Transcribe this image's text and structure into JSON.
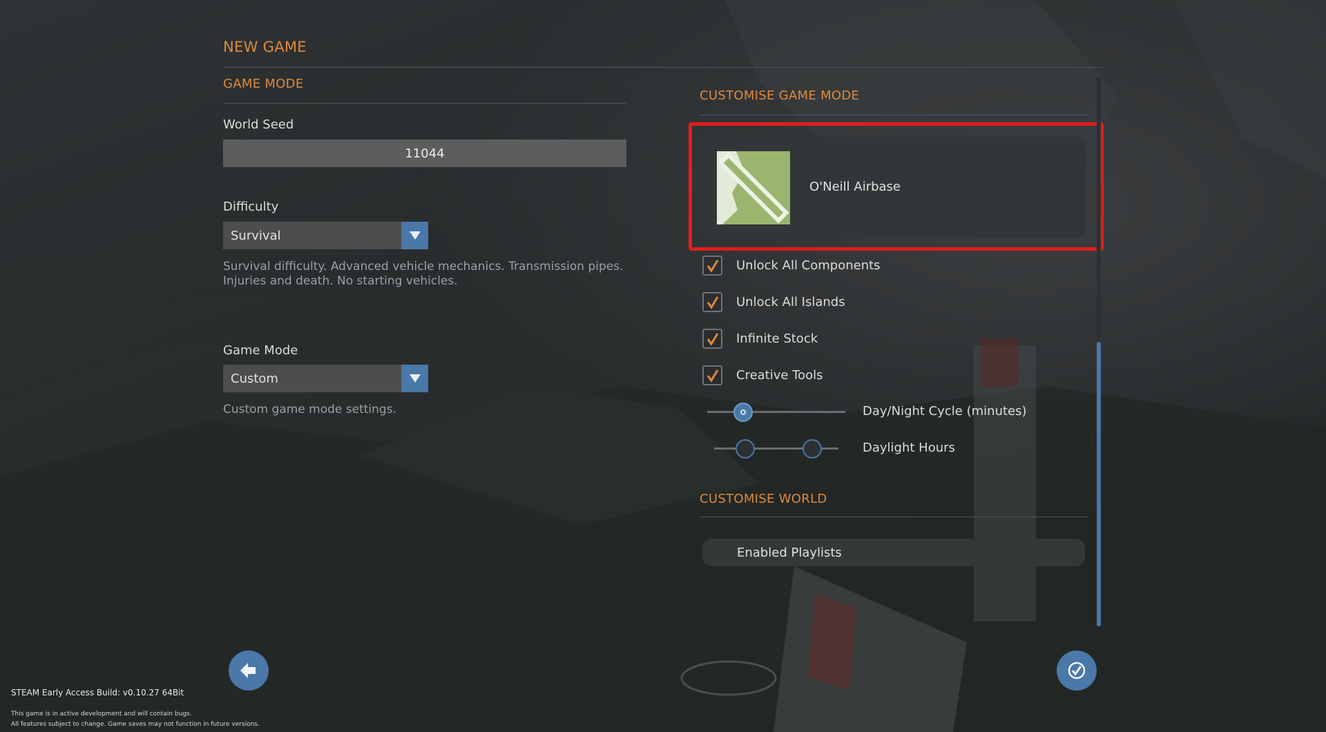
{
  "page": {
    "title": "NEW GAME",
    "accent_color": "#e0893c",
    "button_color": "#4a78a8",
    "highlight_color": "#e31d1d"
  },
  "game_mode_section": {
    "heading": "GAME MODE",
    "world_seed": {
      "label": "World Seed",
      "value": "11044"
    },
    "difficulty": {
      "label": "Difficulty",
      "selected": "Survival",
      "description": "Survival difficulty. Advanced vehicle mechanics. Transmission pipes. Injuries and death. No starting vehicles."
    },
    "game_mode": {
      "label": "Game Mode",
      "selected": "Custom",
      "description": "Custom game mode settings."
    }
  },
  "customise_game_mode": {
    "heading": "CUSTOMISE GAME MODE",
    "location": {
      "name": "O'Neill Airbase",
      "icon": "airbase-map-icon"
    },
    "options": [
      {
        "label": "Unlock All Components",
        "checked": true
      },
      {
        "label": "Unlock All Islands",
        "checked": true
      },
      {
        "label": "Infinite Stock",
        "checked": true
      },
      {
        "label": "Creative Tools",
        "checked": true
      }
    ],
    "sliders": {
      "day_night": {
        "label": "Day/Night Cycle (minutes)",
        "position_fraction": 0.26
      },
      "daylight": {
        "label": "Daylight Hours",
        "low_fraction": 0.25,
        "high_fraction": 0.79
      }
    }
  },
  "customise_world": {
    "heading": "CUSTOMISE WORLD",
    "playlists_button": "Enabled Playlists"
  },
  "navigation": {
    "back_icon": "arrow-left-icon",
    "confirm_icon": "checkmark-icon"
  },
  "footer": {
    "build": "STEAM Early Access Build: v0.10.27 64Bit",
    "note1": "This game is in active development and will contain bugs.",
    "note2": "All features subject to change. Game saves may not function in future versions."
  }
}
